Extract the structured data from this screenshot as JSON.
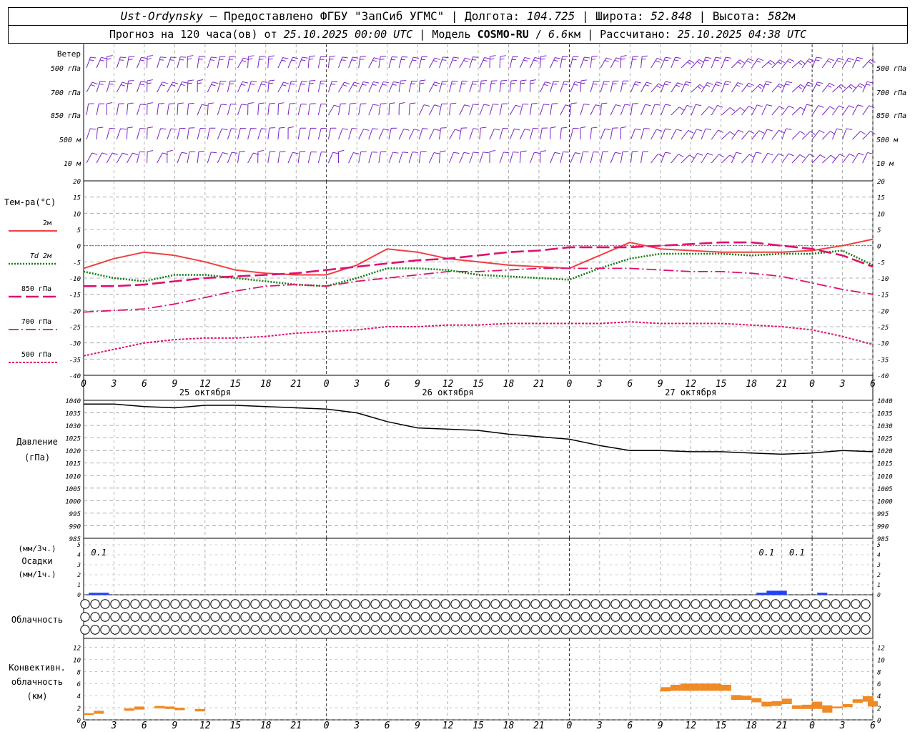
{
  "header": {
    "line1": {
      "place": "Ust-Ordynsky",
      "provider": " — Предоставлено ФГБУ \"ЗапСиб УГМС\" | Долгота: ",
      "lon": "104.725",
      "lat_label": " | Широта: ",
      "lat": "52.848",
      "alt_label": " | Высота: ",
      "alt": "582",
      "alt_unit": "м"
    },
    "line2": {
      "forecast_label": "Прогноз на 120 часа(ов) от ",
      "start": "25.10.2025 00:00 UTC",
      "model_label": " | Модель ",
      "model": "COSMO-RU",
      "model_sep": " / ",
      "res": "6.6",
      "res_unit": "км",
      "calc_label": " | Рассчитано: ",
      "calc": "25.10.2025 04:38 UTC"
    }
  },
  "x_axis": {
    "hour_ticks": [
      "0",
      "3",
      "6",
      "9",
      "12",
      "15",
      "18",
      "21",
      "0",
      "3",
      "6",
      "9",
      "12",
      "15",
      "18",
      "21",
      "0",
      "3",
      "6",
      "9",
      "12",
      "15",
      "18",
      "21",
      "0",
      "3",
      "6"
    ],
    "day_labels": [
      "25 октября",
      "26 октября",
      "27 октября"
    ]
  },
  "wind_panel": {
    "title": "Ветер",
    "levels": [
      "500 гПа",
      "700 гПа",
      "850 гПа",
      "500 м",
      "10 м"
    ]
  },
  "temp_panel": {
    "title": "Тем-ра(°C)",
    "legend": [
      {
        "label": "2м",
        "color": "#f04040"
      },
      {
        "label": "Td 2м",
        "color": "#108010"
      },
      {
        "label": "850 гПа",
        "color": "#e0106e"
      },
      {
        "label": "700 гПа",
        "color": "#e0106e"
      },
      {
        "label": "500 гПа",
        "color": "#e0106e"
      }
    ],
    "ticks": [
      "20",
      "15",
      "10",
      "5",
      "0",
      "-5",
      "-10",
      "-15",
      "-20",
      "-25",
      "-30",
      "-35",
      "-40"
    ]
  },
  "pressure_panel": {
    "title1": "Давление",
    "title2": "(гПа)",
    "ticks": [
      "1040",
      "1035",
      "1030",
      "1025",
      "1020",
      "1015",
      "1010",
      "1005",
      "1000",
      "995",
      "990",
      "985"
    ]
  },
  "precip_panel": {
    "title1": "(мм/3ч.)",
    "title2": "Осадки",
    "title3": "(мм/1ч.)",
    "ticks": [
      "5",
      "4",
      "3",
      "2",
      "1",
      "0"
    ],
    "annotations": [
      "0.1",
      "0.1",
      "0.1"
    ]
  },
  "cloud_panel": {
    "title": "Облачность"
  },
  "conv_panel": {
    "title1": "Конвективн.",
    "title2": "облачность",
    "title3": "(км)",
    "ticks": [
      "12",
      "10",
      "8",
      "6",
      "4",
      "2",
      "0"
    ]
  },
  "chart_data": [
    {
      "type": "line",
      "name": "temperature",
      "x_hours": [
        0,
        3,
        6,
        9,
        12,
        15,
        18,
        21,
        24,
        27,
        30,
        33,
        36,
        39,
        42,
        45,
        48,
        51,
        54,
        57,
        60,
        63,
        66,
        69,
        72,
        75,
        78
      ],
      "ylim": [
        -40,
        20
      ],
      "series": [
        {
          "name": "2м",
          "color": "#f04040",
          "values": [
            -7,
            -4,
            -2,
            -3,
            -5,
            -7.5,
            -8.5,
            -9,
            -9,
            -6,
            -1,
            -2,
            -4,
            -5,
            -6,
            -6.5,
            -7,
            -3,
            1,
            -1,
            -1.5,
            -2,
            -2,
            -2,
            -1.5,
            0,
            2
          ]
        },
        {
          "name": "Td 2м",
          "color": "#108010",
          "values": [
            -8,
            -10,
            -11,
            -9,
            -9,
            -10,
            -11,
            -12,
            -12.5,
            -10,
            -7,
            -7,
            -7.5,
            -9,
            -9.5,
            -10,
            -10.5,
            -7,
            -4,
            -2.5,
            -2.5,
            -2.5,
            -3,
            -2.5,
            -2.5,
            -1.5,
            -6
          ]
        },
        {
          "name": "850 гПа",
          "color": "#e0106e",
          "values": [
            -12.5,
            -12.5,
            -12,
            -11,
            -10,
            -9.5,
            -9,
            -8.5,
            -7.5,
            -6.5,
            -5.5,
            -4.5,
            -4,
            -3,
            -2,
            -1.5,
            -0.5,
            -0.5,
            -0.5,
            0,
            0.5,
            1,
            1,
            0,
            -1,
            -3,
            -6.5
          ]
        },
        {
          "name": "700 гПа",
          "color": "#e0106e",
          "values": [
            -20.5,
            -20,
            -19.5,
            -18,
            -16,
            -14,
            -12.5,
            -12,
            -12.5,
            -11,
            -10,
            -9,
            -8,
            -8,
            -7.5,
            -7,
            -7,
            -7,
            -7,
            -7.5,
            -8,
            -8,
            -8.5,
            -9.5,
            -11.5,
            -13.5,
            -15
          ]
        },
        {
          "name": "500 гПа",
          "color": "#e0106e",
          "values": [
            -34,
            -32,
            -30,
            -29,
            -28.5,
            -28.5,
            -28,
            -27,
            -26.5,
            -26,
            -25,
            -25,
            -24.5,
            -24.5,
            -24,
            -24,
            -24,
            -24,
            -23.5,
            -24,
            -24,
            -24,
            -24.5,
            -25,
            -26,
            -28,
            -30.5
          ]
        }
      ]
    },
    {
      "type": "line",
      "name": "pressure",
      "x_hours": [
        0,
        3,
        6,
        9,
        12,
        15,
        18,
        21,
        24,
        27,
        30,
        33,
        36,
        39,
        42,
        45,
        48,
        51,
        54,
        57,
        60,
        63,
        66,
        69,
        72,
        75,
        78
      ],
      "ylim": [
        985,
        1040
      ],
      "series": [
        {
          "name": "Давление",
          "color": "#000000",
          "values": [
            1038.5,
            1038.5,
            1037.5,
            1037,
            1038,
            1038,
            1037.5,
            1037,
            1036.5,
            1035,
            1031.5,
            1029,
            1028.5,
            1028,
            1026.5,
            1025.5,
            1024.5,
            1022,
            1020,
            1020,
            1019.5,
            1019.5,
            1019,
            1018.5,
            1019,
            1020,
            1019.5
          ]
        }
      ]
    },
    {
      "type": "bar",
      "name": "precipitation",
      "ylim": [
        0,
        5
      ],
      "points": [
        {
          "x": 1,
          "value": 0.1,
          "color": "#2040ff"
        },
        {
          "x": 2,
          "value": 0.1,
          "color": "#2040ff"
        },
        {
          "x": 67,
          "value": 0.1,
          "color": "#2040ff"
        },
        {
          "x": 68,
          "value": 0.2,
          "color": "#2040ff"
        },
        {
          "x": 69,
          "value": 0.2,
          "color": "#2040ff"
        },
        {
          "x": 73,
          "value": 0.1,
          "color": "#2040ff"
        }
      ]
    },
    {
      "type": "heatmap",
      "name": "cloudiness",
      "rows": [
        "high",
        "mid",
        "low"
      ],
      "values": [
        [
          0,
          0,
          0,
          0,
          0,
          0,
          0,
          0,
          0,
          0,
          0,
          0,
          0,
          0,
          0,
          0,
          0,
          0,
          0,
          0,
          0,
          0,
          0,
          0,
          0,
          0,
          0,
          0,
          0,
          0,
          0,
          0,
          0,
          0,
          0,
          0,
          0,
          0,
          0,
          0,
          0,
          0,
          0,
          0,
          0,
          0,
          0,
          0,
          0,
          0,
          0,
          0,
          0,
          0,
          0,
          0,
          0,
          0,
          0,
          0,
          0,
          0,
          0,
          0,
          0,
          0,
          0,
          0,
          0,
          0,
          0,
          0,
          0,
          0,
          0,
          0,
          0,
          0,
          0,
          0
        ],
        [
          0,
          0,
          0,
          0,
          0,
          0,
          0,
          0,
          0,
          0,
          0,
          0,
          0,
          0,
          0,
          0,
          0,
          0,
          0,
          0,
          0,
          0,
          0,
          0,
          0,
          0,
          0,
          0,
          0,
          0,
          0,
          0,
          0,
          0,
          0,
          0,
          0,
          0,
          0,
          0,
          0,
          0,
          0,
          0,
          0,
          0,
          0,
          0,
          0,
          0,
          0,
          0,
          0,
          0,
          0,
          0,
          0,
          0,
          0,
          0,
          0,
          0,
          0,
          0,
          0,
          0,
          0,
          0,
          0,
          0,
          0,
          0,
          0,
          0,
          0,
          0,
          0,
          0,
          0,
          0
        ],
        [
          0,
          0,
          0,
          0,
          0,
          0,
          0,
          0,
          0,
          0,
          0,
          0,
          0,
          0,
          0,
          0,
          0,
          0,
          0,
          0,
          0,
          0,
          0,
          0,
          0,
          0,
          0,
          0,
          0,
          0,
          0,
          0,
          0,
          0,
          0,
          0,
          0,
          0,
          0,
          0,
          0,
          0,
          0,
          0,
          0,
          0,
          0,
          0,
          0,
          0,
          0,
          0,
          0,
          0,
          0,
          0,
          0,
          0,
          0,
          0,
          0,
          0,
          0,
          0,
          0,
          0,
          0,
          0,
          0,
          0,
          0,
          0,
          0,
          0,
          0,
          0,
          0,
          0,
          0,
          0
        ]
      ]
    },
    {
      "type": "bar",
      "name": "convective_cloud",
      "ylim": [
        0,
        13
      ],
      "points": [
        {
          "x": 0.5,
          "bottom": 0.8,
          "top": 1.1,
          "color": "#f08a24"
        },
        {
          "x": 1.5,
          "bottom": 1.0,
          "top": 1.5,
          "color": "#f08a24"
        },
        {
          "x": 4.5,
          "bottom": 1.5,
          "top": 1.9,
          "color": "#f08a24"
        },
        {
          "x": 5.5,
          "bottom": 1.7,
          "top": 2.2,
          "color": "#f08a24"
        },
        {
          "x": 7.5,
          "bottom": 1.9,
          "top": 2.3,
          "color": "#f08a24"
        },
        {
          "x": 8.5,
          "bottom": 1.8,
          "top": 2.2,
          "color": "#f08a24"
        },
        {
          "x": 9.5,
          "bottom": 1.6,
          "top": 2.0,
          "color": "#f08a24"
        },
        {
          "x": 11.5,
          "bottom": 1.4,
          "top": 1.8,
          "color": "#f08a24"
        },
        {
          "x": 57.5,
          "bottom": 4.7,
          "top": 5.4,
          "color": "#f08a24"
        },
        {
          "x": 58.5,
          "bottom": 4.8,
          "top": 5.8,
          "color": "#f08a24"
        },
        {
          "x": 59.5,
          "bottom": 4.8,
          "top": 6.0,
          "color": "#f08a24"
        },
        {
          "x": 60.5,
          "bottom": 4.8,
          "top": 6.0,
          "color": "#f08a24"
        },
        {
          "x": 61.5,
          "bottom": 4.8,
          "top": 6.0,
          "color": "#f08a24"
        },
        {
          "x": 62.5,
          "bottom": 4.8,
          "top": 6.0,
          "color": "#f08a24"
        },
        {
          "x": 63.5,
          "bottom": 4.8,
          "top": 5.8,
          "color": "#f08a24"
        },
        {
          "x": 64.5,
          "bottom": 3.3,
          "top": 4.1,
          "color": "#f08a24"
        },
        {
          "x": 65.5,
          "bottom": 3.3,
          "top": 4.0,
          "color": "#f08a24"
        },
        {
          "x": 66.5,
          "bottom": 2.9,
          "top": 3.6,
          "color": "#f08a24"
        },
        {
          "x": 67.5,
          "bottom": 2.2,
          "top": 3.0,
          "color": "#f08a24"
        },
        {
          "x": 68.5,
          "bottom": 2.3,
          "top": 3.1,
          "color": "#f08a24"
        },
        {
          "x": 69.5,
          "bottom": 2.6,
          "top": 3.5,
          "color": "#f08a24"
        },
        {
          "x": 70.5,
          "bottom": 1.8,
          "top": 2.4,
          "color": "#f08a24"
        },
        {
          "x": 71.5,
          "bottom": 1.8,
          "top": 2.5,
          "color": "#f08a24"
        },
        {
          "x": 72.5,
          "bottom": 1.8,
          "top": 3.0,
          "color": "#f08a24"
        },
        {
          "x": 73.5,
          "bottom": 1.2,
          "top": 2.4,
          "color": "#f08a24"
        },
        {
          "x": 74.5,
          "bottom": 1.9,
          "top": 2.2,
          "color": "#f08a24"
        },
        {
          "x": 75.5,
          "bottom": 2.1,
          "top": 2.6,
          "color": "#f08a24"
        },
        {
          "x": 76.5,
          "bottom": 2.8,
          "top": 3.4,
          "color": "#f08a24"
        },
        {
          "x": 77.5,
          "bottom": 3.0,
          "top": 3.9,
          "color": "#f08a24"
        },
        {
          "x": 78,
          "bottom": 2.2,
          "top": 3.1,
          "color": "#f08a24"
        }
      ]
    }
  ],
  "colors": {
    "wind": "#7a23c8",
    "grid": "#9e9e9e",
    "zero_line": "#3050ff"
  }
}
